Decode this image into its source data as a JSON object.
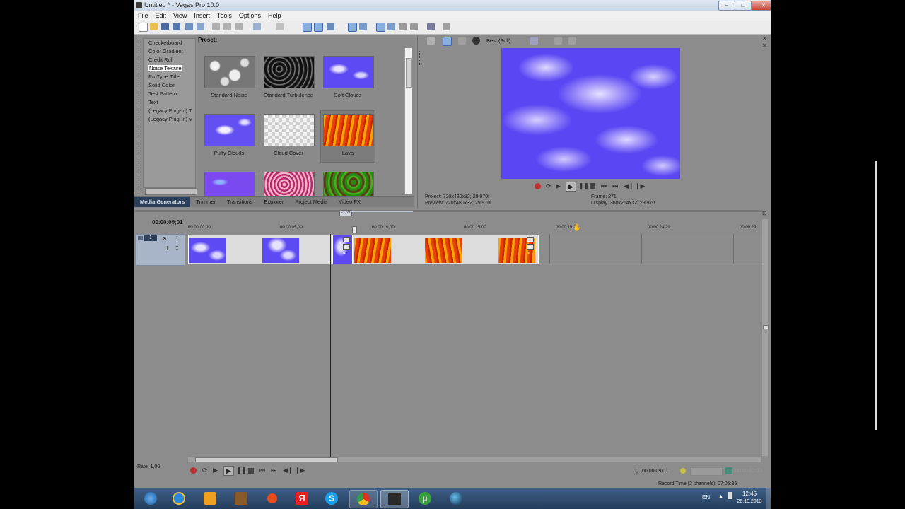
{
  "window": {
    "title": "Untitled * - Vegas Pro 10.0",
    "buttons": {
      "minimize": "–",
      "maximize": "□",
      "close": "✕"
    }
  },
  "menu": [
    "File",
    "Edit",
    "View",
    "Insert",
    "Tools",
    "Options",
    "Help"
  ],
  "generators": {
    "items": [
      "Checkerboard",
      "Color Gradient",
      "Credit Roll",
      "Noise Texture",
      "ProType Titler",
      "Solid Color",
      "Test Pattern",
      "Text",
      "(Legacy Plug-In) T",
      "(Legacy Plug-In) V"
    ],
    "selected_index": 3,
    "preset_label": "Preset:",
    "presets": [
      {
        "label": "Standard Noise",
        "texture": "gray-noise"
      },
      {
        "label": "Standard Turbulence",
        "texture": "black-turbulence"
      },
      {
        "label": "Soft Clouds",
        "texture": "blue-clouds"
      },
      {
        "label": "Puffy Clouds",
        "texture": "blue-clouds"
      },
      {
        "label": "Cloud Cover",
        "texture": "checker"
      },
      {
        "label": "Lava",
        "texture": "lava"
      },
      {
        "label": "",
        "texture": "blue-purple"
      },
      {
        "label": "",
        "texture": "pink-noise"
      },
      {
        "label": "",
        "texture": "green-camo"
      }
    ]
  },
  "tabs": [
    "Media Generators",
    "Trimmer",
    "Transitions",
    "Explorer",
    "Project Media",
    "Video FX"
  ],
  "preview": {
    "quality": "Best (Full)",
    "project": "Project:  720x480x32; 29,970i",
    "preview": "Preview:  720x480x32; 29,970i",
    "frame": "Frame:     271",
    "display": "Display:   360x264x32; 29,970"
  },
  "timeline": {
    "current_time": "00:00:09;01",
    "marker_label": "-3,69",
    "track_number": "1",
    "ruler_ticks": [
      "00:00:00;00",
      "00:00:05;00",
      "00:00:10;00",
      "00:00:15;00",
      "00:00:19;29",
      "00:00:24;29",
      "00:00:29;"
    ],
    "rate": "Rate: 1,00",
    "time_display": "00:00:09;01",
    "end_time": "00:00:00;00",
    "record_time": "Record Time (2 channels): 07:05:35"
  },
  "taskbar": {
    "lang": "EN",
    "time": "12:45",
    "date": "26.10.2013",
    "apps": [
      "start-button",
      "ie-icon",
      "media-player-icon",
      "game-icon",
      "opera-icon",
      "yandex-icon",
      "skype-icon",
      "chrome-icon",
      "vegas-taskbar-icon",
      "utorrent-icon",
      "steam-icon"
    ]
  },
  "colors": {
    "accent": "#2b3f5b",
    "clouds": "#6a55f5",
    "lava": "#e8460a"
  }
}
